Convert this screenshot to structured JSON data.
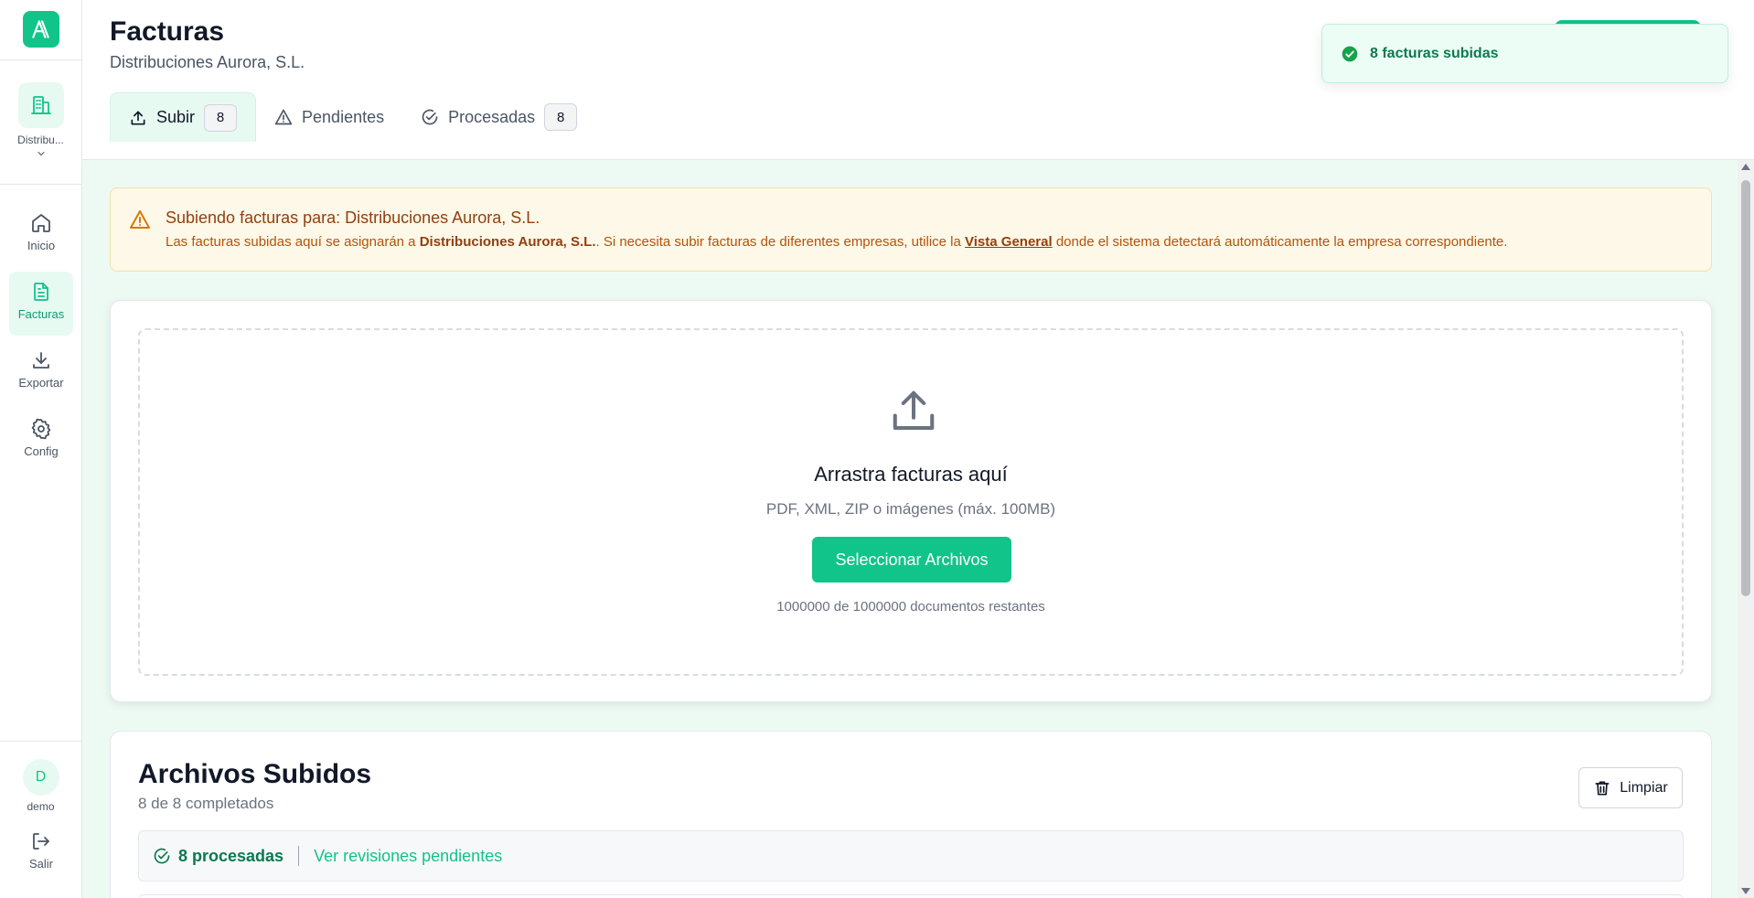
{
  "sidebar": {
    "company_short": "Distribu...",
    "nav": [
      {
        "label": "Inicio"
      },
      {
        "label": "Facturas"
      },
      {
        "label": "Exportar"
      },
      {
        "label": "Config"
      }
    ],
    "user_initial": "D",
    "user_name": "demo",
    "logout_label": "Salir"
  },
  "header": {
    "title": "Facturas",
    "company": "Distribuciones Aurora, S.L.",
    "tabs": [
      {
        "label": "Subir",
        "count": "8",
        "active": true
      },
      {
        "label": "Pendientes",
        "active": false
      },
      {
        "label": "Procesadas",
        "count": "8",
        "active": false
      }
    ]
  },
  "toast": {
    "message": "8 facturas subidas"
  },
  "alert": {
    "title": "Subiendo facturas para: Distribuciones Aurora, S.L.",
    "body_prefix": "Las facturas subidas aquí se asignarán a ",
    "body_company": "Distribuciones Aurora, S.L.",
    "body_middle": ". Si necesita subir facturas de diferentes empresas, utilice la ",
    "body_link": "Vista General",
    "body_suffix": " donde el sistema detectará automáticamente la empresa correspondiente."
  },
  "upload": {
    "title": "Arrastra facturas aquí",
    "formats": "PDF, XML, ZIP o imágenes (máx. 100MB)",
    "button_label": "Seleccionar Archivos",
    "remaining": "1000000 de 1000000 documentos restantes"
  },
  "files": {
    "title": "Archivos Subidos",
    "subtitle": "8 de 8 completados",
    "clear_label": "Limpiar",
    "processed_label": "8 procesadas",
    "pending_link": "Ver revisiones pendientes"
  },
  "colors": {
    "accent": "#10c48a",
    "accent_light": "#e7faf2",
    "warning_bg": "#fdf8e8",
    "warning_text": "#b45309",
    "success_text": "#0b7a4e"
  },
  "icons": {
    "logo": "logo-icon",
    "company": "building-icon",
    "nav": [
      "home-icon",
      "document-icon",
      "download-icon",
      "gear-icon"
    ],
    "logout": "logout-icon",
    "tabs": [
      "upload-icon",
      "warning-icon",
      "check-circle-icon"
    ],
    "toast": "check-circle-icon",
    "dropzone": "upload-icon",
    "clear": "trash-icon"
  }
}
